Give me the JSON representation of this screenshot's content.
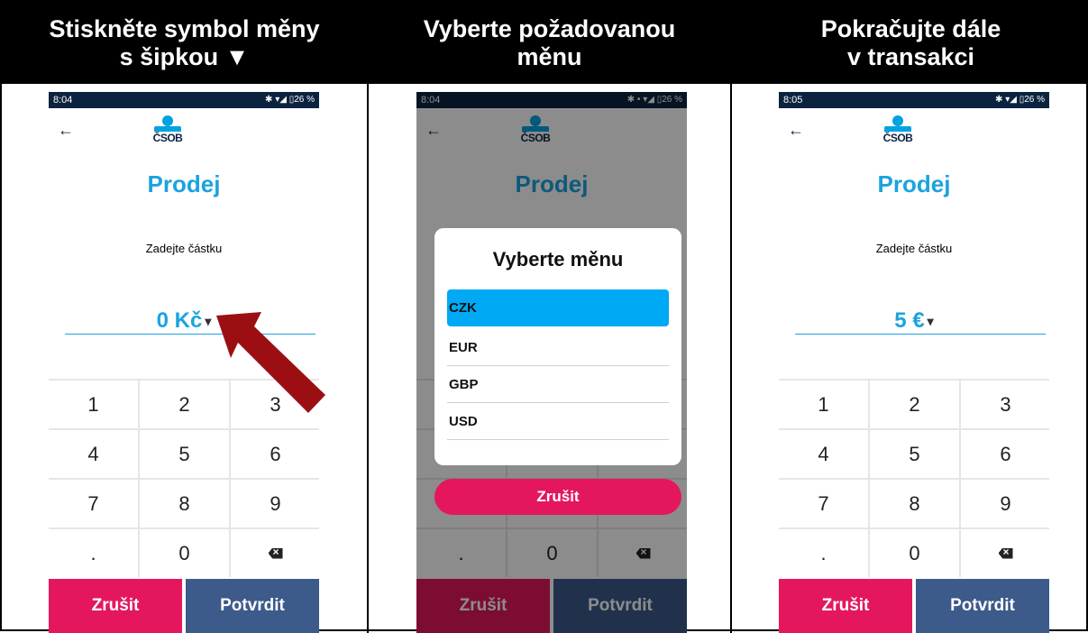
{
  "colors": {
    "accent": "#1ba3e0",
    "cancel": "#e4175e",
    "confirm": "#3c5a8a",
    "selected": "#00a9f4",
    "arrow": "#9b0f12"
  },
  "panels": [
    {
      "header": [
        "Stiskněte symbol měny",
        "s šipkou ▼"
      ],
      "status_time": "8:04",
      "status_icons": "✱ ▾◢ ▯26 %",
      "logo": "ČSOB",
      "title": "Prodej",
      "prompt": "Zadejte částku",
      "amount": "0 Kč",
      "caret": "▾",
      "keys": [
        "1",
        "2",
        "3",
        "4",
        "5",
        "6",
        "7",
        "8",
        "9",
        ".",
        "0"
      ],
      "cancel": "Zrušit",
      "confirm": "Potvrdit"
    },
    {
      "header": [
        "Vyberte požadovanou",
        "měnu"
      ],
      "status_time": "8:04",
      "status_icons": "✱ • ▾◢ ▯26 %",
      "logo": "ČSOB",
      "title": "Prodej",
      "dialog_title": "Vyberte měnu",
      "options": [
        "CZK",
        "EUR",
        "GBP",
        "USD"
      ],
      "selected": "CZK",
      "dialog_cancel": "Zrušit",
      "keys": [
        "0"
      ],
      "cancel": "Zrušit",
      "confirm": "Potvrdit"
    },
    {
      "header": [
        "Pokračujte dále",
        "v transakci"
      ],
      "status_time": "8:05",
      "status_icons": "✱ ▾◢ ▯26 %",
      "logo": "ČSOB",
      "title": "Prodej",
      "prompt": "Zadejte částku",
      "amount": "5 €",
      "caret": "▾",
      "keys": [
        "1",
        "2",
        "3",
        "4",
        "5",
        "6",
        "7",
        "8",
        "9",
        ".",
        "0"
      ],
      "cancel": "Zrušit",
      "confirm": "Potvrdit"
    }
  ]
}
